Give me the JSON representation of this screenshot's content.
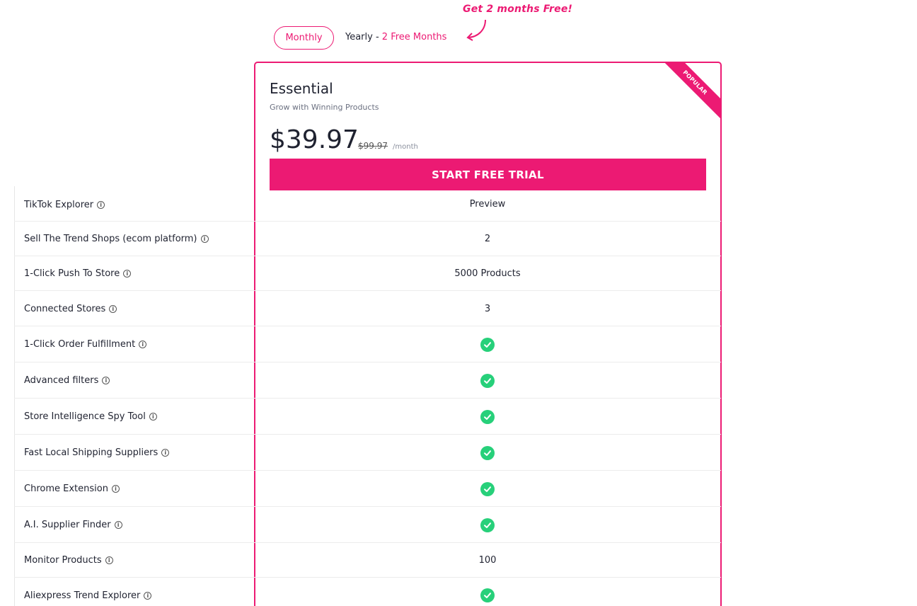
{
  "promo": {
    "text": "Get 2 months Free!"
  },
  "billing_toggle": {
    "monthly_label": "Monthly",
    "yearly_label": "Yearly - ",
    "yearly_accent": "2 Free Months"
  },
  "plan": {
    "badge": "POPULAR",
    "name": "Essential",
    "subtitle": "Grow with Winning Products",
    "price": "$39.97",
    "old_price": "$99.97",
    "period": "/month",
    "cta_label": "START FREE TRIAL"
  },
  "colors": {
    "accent": "#ec1a73",
    "check": "#27d07a"
  },
  "features": [
    {
      "label": "TikTok Explorer",
      "value": "Preview",
      "check": false
    },
    {
      "label": "Sell The Trend Shops (ecom platform)",
      "value": "2",
      "check": false
    },
    {
      "label": "1-Click Push To Store",
      "value": "5000 Products",
      "check": false
    },
    {
      "label": "Connected Stores",
      "value": "3",
      "check": false
    },
    {
      "label": "1-Click Order Fulfillment",
      "value": "",
      "check": true
    },
    {
      "label": "Advanced filters",
      "value": "",
      "check": true
    },
    {
      "label": "Store Intelligence Spy Tool",
      "value": "",
      "check": true
    },
    {
      "label": "Fast Local Shipping Suppliers",
      "value": "",
      "check": true
    },
    {
      "label": "Chrome Extension",
      "value": "",
      "check": true
    },
    {
      "label": "A.I. Supplier Finder",
      "value": "",
      "check": true
    },
    {
      "label": "Monitor Products",
      "value": "100",
      "check": false
    },
    {
      "label": "Aliexpress Trend Explorer",
      "value": "",
      "check": true
    }
  ]
}
